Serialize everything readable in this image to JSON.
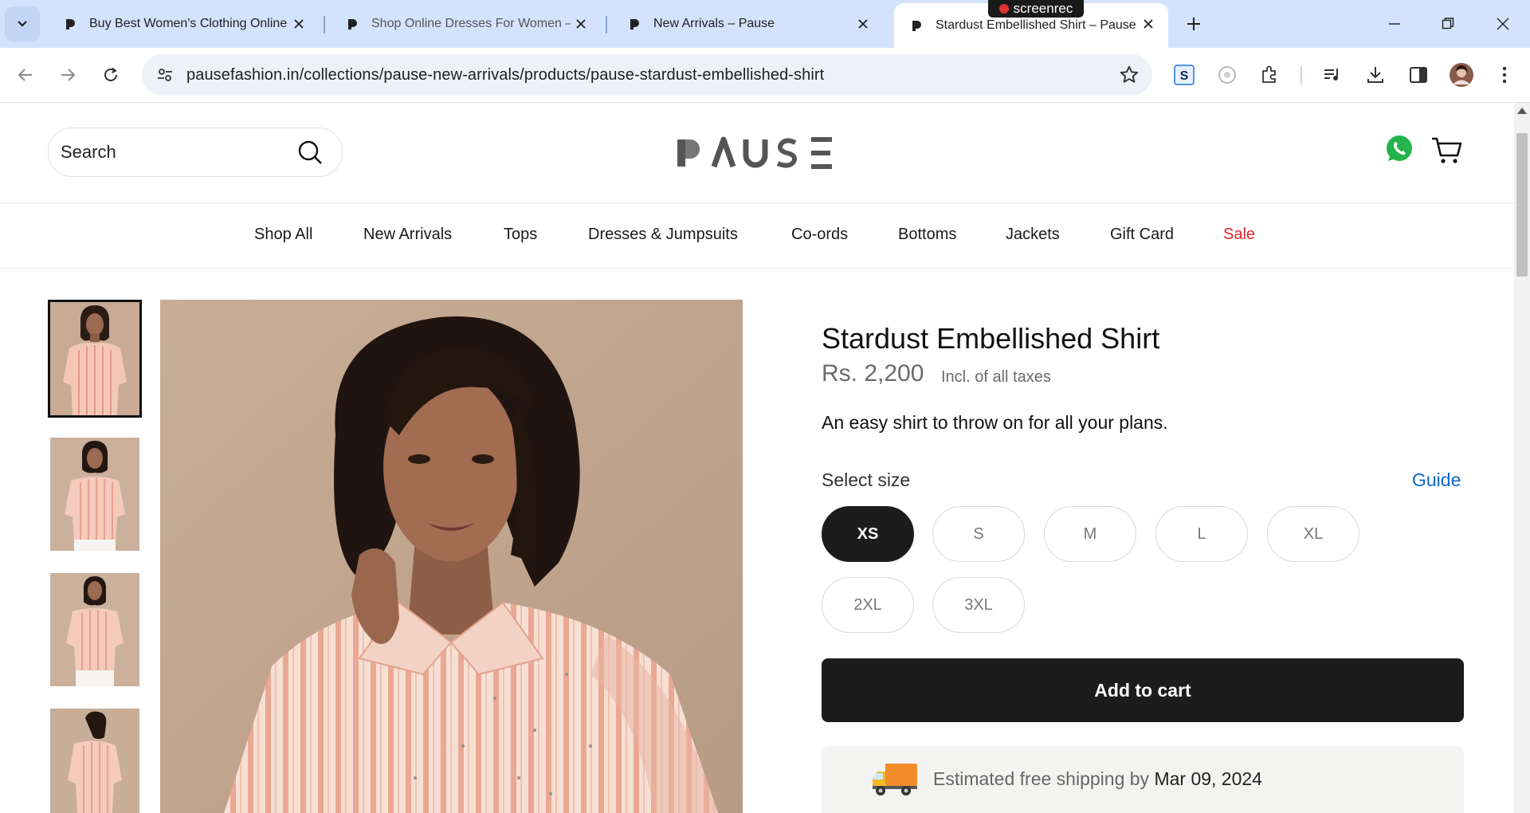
{
  "browser": {
    "tabs": [
      {
        "title": "Buy Best Women's Clothing Online",
        "active": false
      },
      {
        "title": "Shop Online Dresses For Women – ",
        "active": false
      },
      {
        "title": "New Arrivals – Pause",
        "active": false
      },
      {
        "title": "Stardust Embellished Shirt – Pause",
        "active": true
      }
    ],
    "url": "pausefashion.in/collections/pause-new-arrivals/products/pause-stardust-embellished-shirt",
    "recorder_label": "screenrec",
    "extensions": [
      "s-extension-icon",
      "camera-extension-icon",
      "puzzle-icon",
      "media-control-icon",
      "download-icon",
      "sidepanel-icon",
      "profile-avatar",
      "more-menu-icon"
    ]
  },
  "header": {
    "search_placeholder": "Search",
    "logo_text": "PAUSE"
  },
  "nav": {
    "items": [
      {
        "label": "Shop All"
      },
      {
        "label": "New Arrivals"
      },
      {
        "label": "Tops"
      },
      {
        "label": "Dresses & Jumpsuits"
      },
      {
        "label": "Co-ords"
      },
      {
        "label": "Bottoms"
      },
      {
        "label": "Jackets"
      },
      {
        "label": "Gift Card"
      },
      {
        "label": "Sale"
      }
    ],
    "sale_color": "#e0262b"
  },
  "product": {
    "title": "Stardust Embellished Shirt",
    "price": "Rs. 2,200",
    "tax_note": "Incl. of all taxes",
    "description": "An easy shirt to throw on for all your plans.",
    "size_label": "Select size",
    "guide_label": "Guide",
    "sizes": [
      "XS",
      "S",
      "M",
      "L",
      "XL",
      "2XL",
      "3XL"
    ],
    "selected_size": "XS",
    "add_to_cart": "Add to cart",
    "shipping_text": "Estimated free shipping by",
    "shipping_date": "Mar 09, 2024",
    "thumbnails_count": 4,
    "selected_thumbnail": 1
  },
  "colors": {
    "accent_dark": "#1c1c1c",
    "link_blue": "#0d67c7",
    "whatsapp_green": "#25b34b",
    "tabbar_bg": "#d3e3fd"
  }
}
